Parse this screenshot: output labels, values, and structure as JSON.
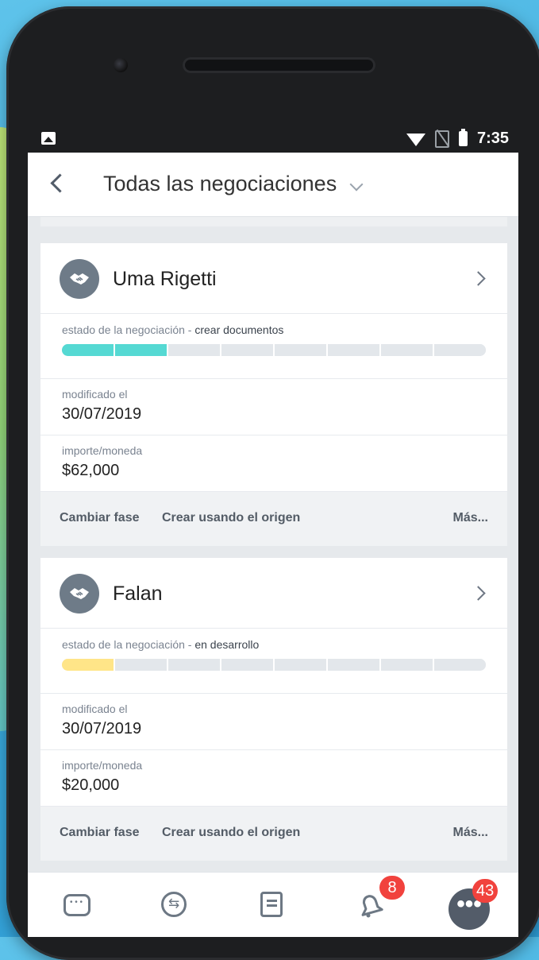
{
  "status_bar": {
    "time": "7:35"
  },
  "header": {
    "title": "Todas las negociaciones"
  },
  "deals": [
    {
      "name": "Uma Rigetti",
      "stage_label": "estado de la negociación - ",
      "stage_value": "crear documentos",
      "progress_segments_filled": 2,
      "progress_segments_total": 8,
      "progress_color": "#55d9d3",
      "modified_label": "modificado el",
      "modified_value": "30/07/2019",
      "amount_label": "importe/moneda",
      "amount_value": "$62,000",
      "actions": [
        "Cambiar fase",
        "Crear usando el origen",
        "Más..."
      ]
    },
    {
      "name": "Falan",
      "stage_label": "estado de la negociación - ",
      "stage_value": "en desarrollo",
      "progress_segments_filled": 1,
      "progress_segments_total": 8,
      "progress_color": "#ffe588",
      "modified_label": "modificado el",
      "modified_value": "30/07/2019",
      "amount_label": "importe/moneda",
      "amount_value": "$20,000",
      "actions": [
        "Cambiar fase",
        "Crear usando el origen",
        "Más..."
      ]
    }
  ],
  "bottom_nav": {
    "items": [
      "chat-icon",
      "activity-stream-icon",
      "tasks-icon",
      "notifications-icon",
      "more-icon"
    ],
    "notifications_badge": "8",
    "more_badge": "43",
    "more_label": "•••"
  },
  "colors": {
    "accent_badge": "#f1423d",
    "progress_track": "#e3e7eb"
  }
}
